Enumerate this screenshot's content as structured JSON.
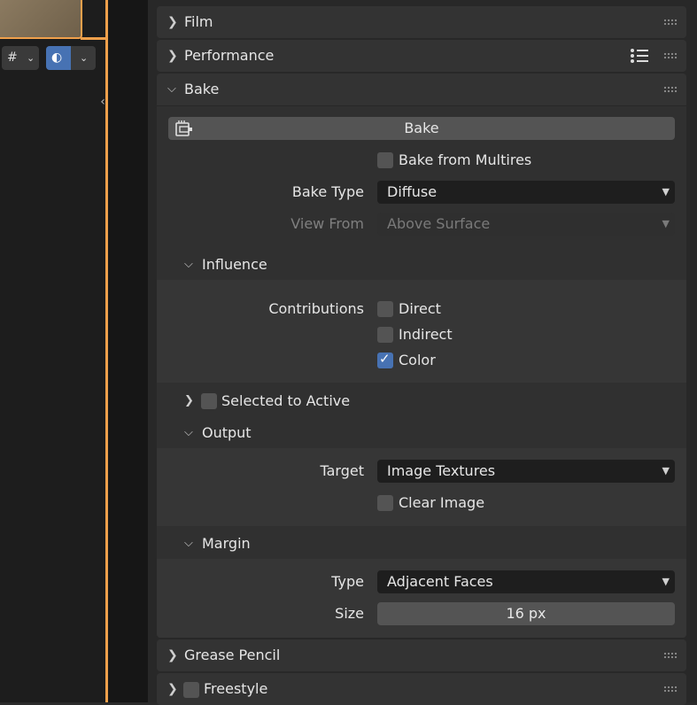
{
  "panels": {
    "film": {
      "title": "Film"
    },
    "performance": {
      "title": "Performance"
    },
    "bake": {
      "title": "Bake",
      "bake_button_label": "Bake",
      "bake_from_multires_label": "Bake from Multires",
      "bake_from_multires_checked": false,
      "bake_type_label": "Bake Type",
      "bake_type_value": "Diffuse",
      "view_from_label": "View From",
      "view_from_value": "Above Surface",
      "influence": {
        "title": "Influence",
        "contributions_label": "Contributions",
        "direct_label": "Direct",
        "direct_checked": false,
        "indirect_label": "Indirect",
        "indirect_checked": false,
        "color_label": "Color",
        "color_checked": true
      },
      "selected_to_active": {
        "title": "Selected to Active",
        "checked": false
      },
      "output": {
        "title": "Output",
        "target_label": "Target",
        "target_value": "Image Textures",
        "clear_image_label": "Clear Image",
        "clear_image_checked": false
      },
      "margin": {
        "title": "Margin",
        "type_label": "Type",
        "type_value": "Adjacent Faces",
        "size_label": "Size",
        "size_value": "16 px"
      }
    },
    "grease_pencil": {
      "title": "Grease Pencil"
    },
    "freestyle": {
      "title": "Freestyle",
      "checked": false
    }
  },
  "icons": {
    "collapsed": "chevron-right-icon",
    "expanded": "chevron-down-icon",
    "drag": "drag-grip-icon",
    "bake": "bake-icon",
    "list": "list-icon"
  },
  "colors": {
    "accent_active": "#4772b3",
    "viewport_border": "#f0a04b"
  }
}
